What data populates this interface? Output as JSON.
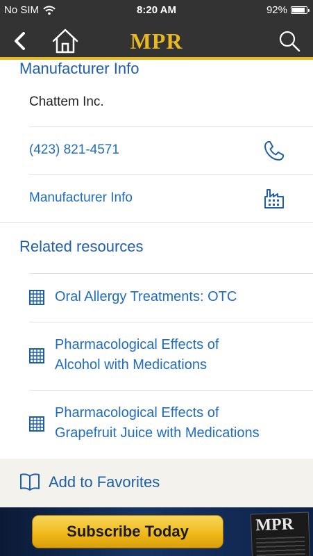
{
  "status_bar": {
    "carrier": "No SIM",
    "time": "8:20 AM",
    "battery": "92%",
    "battery_level": 0.92
  },
  "navbar": {
    "title": "MPR",
    "back_icon": "chevron-left-icon",
    "home_icon": "home-icon",
    "search_icon": "search-icon"
  },
  "manufacturer": {
    "section_title": "Manufacturer Info",
    "name": "Chattem Inc.",
    "phone": "(423) 821-4571",
    "info_link": "Manufacturer Info"
  },
  "related": {
    "title": "Related resources",
    "items": [
      {
        "lines": [
          "Oral Allergy Treatments: OTC"
        ]
      },
      {
        "lines": [
          "Pharmacological Effects of",
          "Alcohol with Medications"
        ]
      },
      {
        "lines": [
          "Pharmacological Effects of",
          "Grapefruit Juice with Medications"
        ]
      }
    ]
  },
  "favorites": {
    "label": "Add to Favorites"
  },
  "ad": {
    "button": "Subscribe Today",
    "magazine_title": "MPR"
  },
  "colors": {
    "accent": "#e8b923",
    "link": "#1f6cc0",
    "bar": "#333333"
  }
}
